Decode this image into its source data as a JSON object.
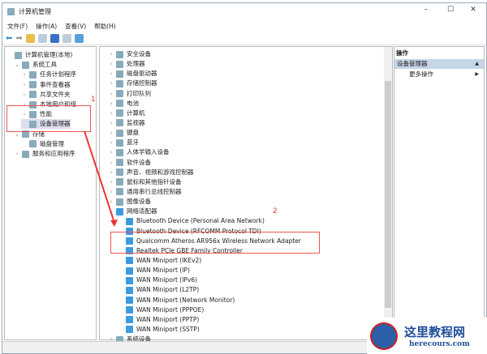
{
  "window": {
    "title": "计算机管理",
    "minimize": "–",
    "maximize": "☐",
    "close": "✕"
  },
  "menu": [
    "文件(F)",
    "操作(A)",
    "查看(V)",
    "帮助(H)"
  ],
  "left_tree": [
    {
      "label": "计算机管理(本地)",
      "level": 0,
      "exp": ""
    },
    {
      "label": "系统工具",
      "level": 1,
      "exp": "⌄"
    },
    {
      "label": "任务计划程序",
      "level": 2,
      "exp": "›"
    },
    {
      "label": "事件查看器",
      "level": 2,
      "exp": "›"
    },
    {
      "label": "共享文件夹",
      "level": 2,
      "exp": "›"
    },
    {
      "label": "本地用户和组",
      "level": 2,
      "exp": "›"
    },
    {
      "label": "性能",
      "level": 2,
      "exp": "›"
    },
    {
      "label": "设备管理器",
      "level": 2,
      "exp": "",
      "selected": true
    },
    {
      "label": "存储",
      "level": 1,
      "exp": "⌄"
    },
    {
      "label": "磁盘管理",
      "level": 2,
      "exp": ""
    },
    {
      "label": "服务和应用程序",
      "level": 1,
      "exp": "›"
    }
  ],
  "devices": [
    {
      "label": "安全设备",
      "exp": "›"
    },
    {
      "label": "处理器",
      "exp": "›"
    },
    {
      "label": "磁盘驱动器",
      "exp": "›"
    },
    {
      "label": "存储控制器",
      "exp": "›"
    },
    {
      "label": "打印队列",
      "exp": "›"
    },
    {
      "label": "电池",
      "exp": "›"
    },
    {
      "label": "计算机",
      "exp": "›"
    },
    {
      "label": "监视器",
      "exp": "›"
    },
    {
      "label": "键盘",
      "exp": "›"
    },
    {
      "label": "蓝牙",
      "exp": "›"
    },
    {
      "label": "人体学输入设备",
      "exp": "›"
    },
    {
      "label": "软件设备",
      "exp": "›"
    },
    {
      "label": "声音、视频和游戏控制器",
      "exp": "›"
    },
    {
      "label": "鼠标和其他指针设备",
      "exp": "›"
    },
    {
      "label": "通用串行总线控制器",
      "exp": "›"
    },
    {
      "label": "图像设备",
      "exp": "›"
    },
    {
      "label": "网络适配器",
      "exp": "⌄",
      "net": true
    },
    {
      "label": "Bluetooth Device (Personal Area Network)",
      "child": true
    },
    {
      "label": "Bluetooth Device (RFCOMM Protocol TDI)",
      "child": true
    },
    {
      "label": "Qualcomm Atheros AR956x Wireless Network Adapter",
      "child": true
    },
    {
      "label": "Realtek PCIe GBE Family Controller",
      "child": true
    },
    {
      "label": "WAN Miniport (IKEv2)",
      "child": true
    },
    {
      "label": "WAN Miniport (IP)",
      "child": true
    },
    {
      "label": "WAN Miniport (IPv6)",
      "child": true
    },
    {
      "label": "WAN Miniport (L2TP)",
      "child": true
    },
    {
      "label": "WAN Miniport (Network Monitor)",
      "child": true
    },
    {
      "label": "WAN Miniport (PPPOE)",
      "child": true
    },
    {
      "label": "WAN Miniport (PPTP)",
      "child": true
    },
    {
      "label": "WAN Miniport (SSTP)",
      "child": true
    },
    {
      "label": "系统设备",
      "exp": "›"
    }
  ],
  "actions": {
    "header": "操作",
    "section": "设备管理器",
    "more": "更多操作"
  },
  "annotations": {
    "one": "1",
    "two": "2"
  },
  "watermark": {
    "cn": "这里教程网",
    "en": "herecours.com",
    "logo": "Z"
  }
}
